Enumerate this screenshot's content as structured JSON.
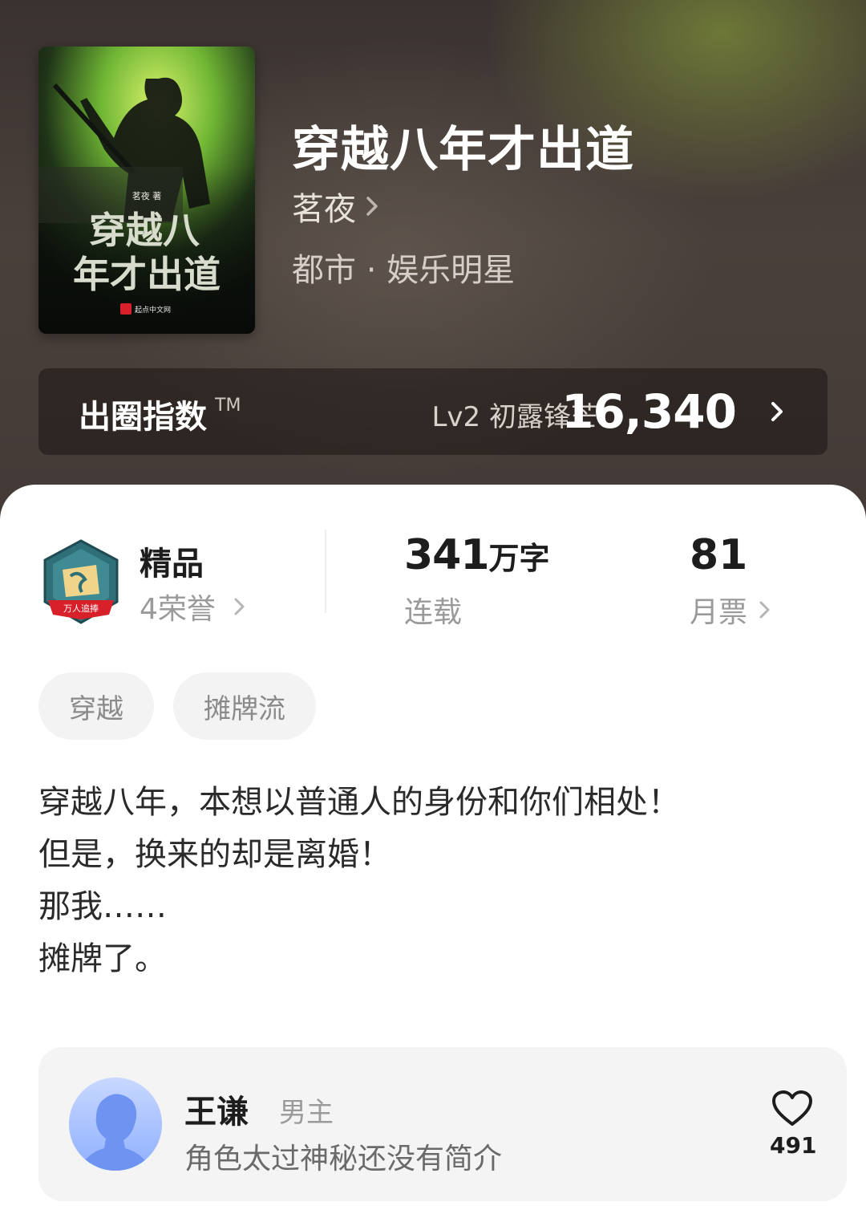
{
  "book": {
    "title": "穿越八年才出道",
    "author": "茗夜",
    "genre": "都市 · 娱乐明星",
    "cover": {
      "author_line": "茗夜 著",
      "title_line1": "穿越八",
      "title_line2": "年才出道",
      "publisher": "起点中文网"
    }
  },
  "index": {
    "label": "出圈指数",
    "tm": "TM",
    "level": "Lv2 初露锋芒",
    "value": "16,340"
  },
  "stats": {
    "honor": {
      "badge_text": "万人追捧",
      "title": "精品",
      "subtitle": "4荣誉"
    },
    "words": {
      "number": "341",
      "unit": "万字",
      "label": "连载"
    },
    "tickets": {
      "number": "81",
      "label": "月票"
    }
  },
  "tags": [
    "穿越",
    "摊牌流"
  ],
  "synopsis": [
    "穿越八年，本想以普通人的身份和你们相处！",
    "但是，换来的却是离婚！",
    "那我……",
    "摊牌了。"
  ],
  "character": {
    "name": "王谦",
    "role": "男主",
    "description": "角色太过神秘还没有简介",
    "likes": "491"
  },
  "colors": {
    "header_dark": "#3a3230",
    "header_glow": "#96af3c",
    "badge_teal": "#2f6f78",
    "badge_ribbon": "#d8202a",
    "avatar_blue": "#9ab8ff"
  }
}
